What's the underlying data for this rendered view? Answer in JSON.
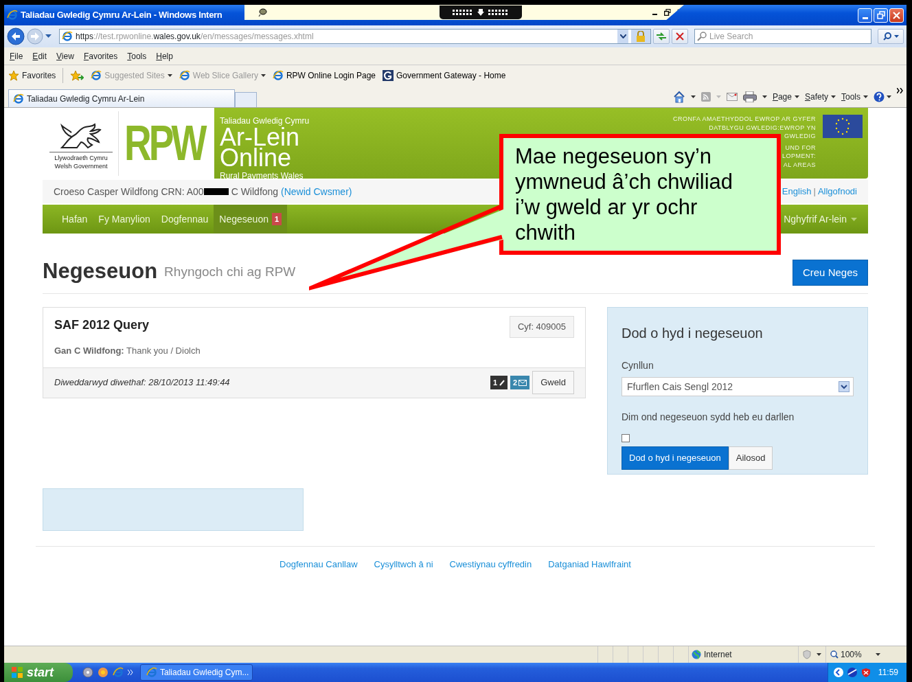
{
  "window": {
    "title": "Taliadau Gwledig Cymru Ar-Lein - Windows Intern"
  },
  "address_bar": {
    "url": [
      {
        "text": "https",
        "dim": false
      },
      {
        "text": "://test.rpwonline.",
        "dim": true
      },
      {
        "text": "wales.gov.uk",
        "dim": false
      },
      {
        "text": "/en/messages/messages.xhtml",
        "dim": true
      }
    ]
  },
  "search": {
    "placeholder": "Live Search"
  },
  "menu": [
    "File",
    "Edit",
    "View",
    "Favorites",
    "Tools",
    "Help"
  ],
  "favorites_bar": {
    "label": "Favorites",
    "items": [
      {
        "label": "Suggested Sites",
        "disabled": true,
        "dropdown": true,
        "kind": "ie"
      },
      {
        "label": "Web Slice Gallery",
        "disabled": true,
        "dropdown": true,
        "kind": "ie"
      },
      {
        "label": "RPW Online Login Page",
        "disabled": false,
        "dropdown": false,
        "kind": "ie"
      },
      {
        "label": "Government Gateway - Home",
        "disabled": false,
        "dropdown": false,
        "kind": "gateway"
      }
    ]
  },
  "tab": {
    "title": "Taliadau Gwledig Cymru Ar-Lein"
  },
  "command_bar": [
    "Page",
    "Safety",
    "Tools"
  ],
  "banner": {
    "gov_lines": [
      "Llywodraeth Cymru",
      "Welsh Government"
    ],
    "logo": "RPW",
    "tagline": "Taliadau Gwledig Cymru",
    "title_lines": [
      "Ar-Lein",
      "Online"
    ],
    "subtitle": "Rural Payments Wales",
    "eu_lines": [
      "CRONFA AMAETHYDDOL EWROP AR GYFER",
      "DATBLYGU GWLEDIG:EWROP YN",
      "GWLEDIG",
      "UND FOR",
      "LOPMENT:",
      "AL AREAS"
    ]
  },
  "welcome": {
    "text": "Croeso Casper Wildfong CRN: A00",
    "redacted": true,
    "name": "C Wildfong",
    "link": "(Newid Cwsmer)",
    "right_links": [
      "English",
      "Allgofnodi"
    ],
    "separator": "|"
  },
  "nav": {
    "items": [
      {
        "label": "Hafan",
        "selected": false
      },
      {
        "label": "Fy Manylion",
        "selected": false
      },
      {
        "label": "Dogfennau",
        "selected": false
      },
      {
        "label": "Negeseuon",
        "selected": true,
        "badge": "1"
      }
    ],
    "account": "Nghyfrif Ar-lein"
  },
  "heading": {
    "title": "Negeseuon",
    "subtitle": "Rhyngoch chi ag RPW",
    "button": "Creu Neges"
  },
  "messages": [
    {
      "subject": "SAF 2012 Query",
      "ref": "Cyf: 409005",
      "from": "**Gan C Wildfong:** Thank you / Diolch",
      "updated": "Diweddarwyd diwethaf: 28/10/2013 11:49:44",
      "attachments": "1",
      "replies": "2",
      "action": "Gweld"
    }
  ],
  "filter": {
    "title": "Dod o hyd i negeseuon",
    "field_label": "Cynllun",
    "select_value": "Ffurflen Cais Sengl 2012",
    "checkbox_label": "Dim ond negeseuon sydd heb eu darllen",
    "checked": false,
    "buttons": [
      "Dod o hyd i negeseuon",
      "Ailosod"
    ]
  },
  "footer": [
    "Dogfennau Canllaw",
    "Cysylltwch â ni",
    "Cwestiynau cyffredin",
    "Datganiad Hawlfraint"
  ],
  "callout": {
    "text": "Mae negeseuon sy’n ymwneud â’ch chwiliad i’w gweld ar yr ochr chwith"
  },
  "status_bar": {
    "zone": "Internet",
    "zoom": "100%"
  },
  "taskbar": {
    "start": "start",
    "task": "Taliadau Gwledig Cym...",
    "time": "11:59"
  }
}
